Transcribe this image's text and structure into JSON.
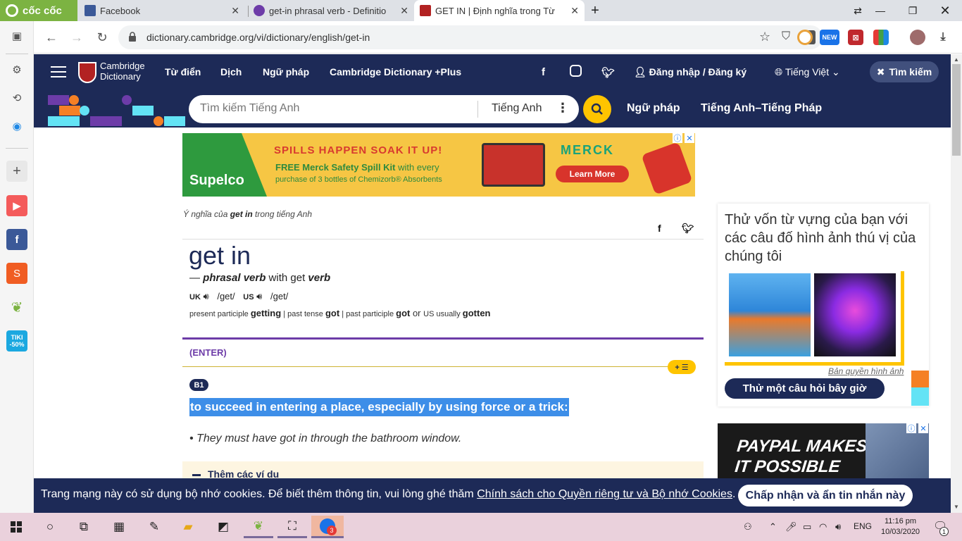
{
  "browser": {
    "brand": "cốc cốc",
    "tabs": [
      {
        "title": "Facebook"
      },
      {
        "title": "get-in phrasal verb - Definitio"
      },
      {
        "title": "GET IN | Định nghĩa trong Từ"
      }
    ],
    "url": "dictionary.cambridge.org/vi/dictionary/english/get-in",
    "new_badge": "NEW",
    "tiki_badge": "TIKI -50%"
  },
  "colors": {
    "nav": "#1d2a57",
    "accent": "#fec400",
    "highlight": "#3d8ee8",
    "purple": "#6d3ca8"
  },
  "site": {
    "logo_line1": "Cambridge",
    "logo_line2": "Dictionary",
    "nav": [
      "Từ điển",
      "Dịch",
      "Ngữ pháp",
      "Cambridge Dictionary +Plus"
    ],
    "login": "Đăng nhập / Đăng ký",
    "language": "Tiếng Việt",
    "search_pill": "Tìm kiếm",
    "search_placeholder": "Tìm kiếm Tiếng Anh",
    "search_lang": "Tiếng Anh",
    "sub_links": [
      "Ngữ pháp",
      "Tiếng Anh–Tiếng Pháp"
    ]
  },
  "ad_top": {
    "brand": "Supelco",
    "headline": "SPILLS HAPPEN SOAK IT UP!",
    "line1_bold": "FREE Merck Safety Spill Kit",
    "line1_rest": " with every",
    "line2": "purchase of 3 bottles of Chemizorb® Absorbents",
    "company": "MERCK",
    "cta": "Learn More"
  },
  "entry": {
    "meaning_prefix": "Ý nghĩa của ",
    "meaning_word": "get in",
    "meaning_suffix": " trong tiếng Anh",
    "headword": "get in",
    "pos_dash": "— ",
    "pos": "phrasal verb",
    "pos_with": " with get ",
    "pos_verb": "verb",
    "uk_label": "UK",
    "uk_ipa": "/ɡet/",
    "us_label": "US",
    "us_ipa": "/ɡet/",
    "inflections": {
      "pp_label": "present participle",
      "pp": "getting",
      "pt_label": "past tense",
      "pt": "got",
      "pap_label": "past participle",
      "pap": "got",
      "or": " or ",
      "us_label": "US usually",
      "us_form": "gotten"
    },
    "guideword": "(ENTER)",
    "level": "B1",
    "definition": "to succeed in entering a place, especially by using force or a trick:",
    "example": "They must have got in through the bathroom window.",
    "more_examples": "Thêm các ví dụ"
  },
  "quiz": {
    "title": "Thử vốn từ vựng của bạn với các câu đố hình ảnh thú vị của chúng tôi",
    "credit": "Bản quyền hình ảnh",
    "button": "Thử một câu hỏi bây giờ"
  },
  "ad_right": {
    "line1": "PAYPAL MAKES",
    "line2": "IT POSSIBLE"
  },
  "cookie": {
    "text": "Trang mạng này có sử dụng bộ nhớ cookies. Để biết thêm thông tin, vui lòng ghé thăm ",
    "link": "Chính sách cho Quyền riêng tư và Bộ nhớ Cookies",
    "end": ".",
    "button": "Chấp nhận và ẩn tin nhắn này"
  },
  "taskbar": {
    "lang": "ENG",
    "time": "11:16 pm",
    "date": "10/03/2020",
    "zalo_badge": "3",
    "notif_badge": "1"
  }
}
